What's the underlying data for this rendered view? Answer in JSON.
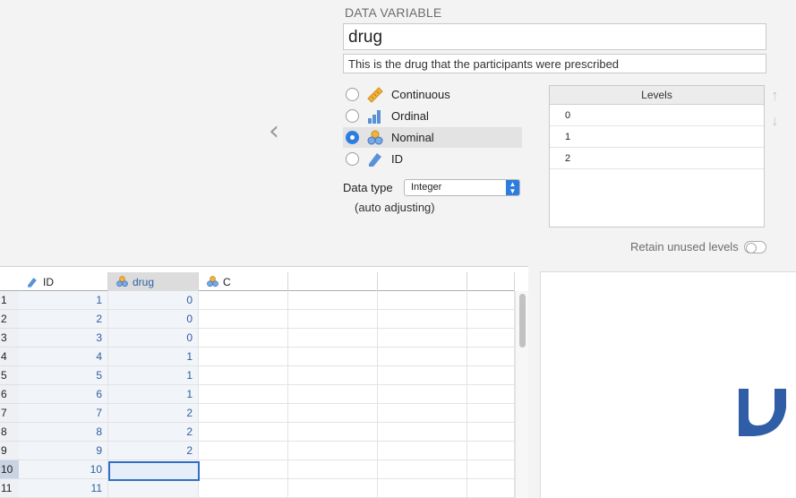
{
  "setup": {
    "back_icon": "chevron-left-icon",
    "section_title": "DATA VARIABLE",
    "variable_name": "drug",
    "description": "This is the drug that the participants were prescribed",
    "measure_types": [
      {
        "label": "Continuous",
        "icon": "ruler-icon",
        "selected": false
      },
      {
        "label": "Ordinal",
        "icon": "bar-chart-icon",
        "selected": false
      },
      {
        "label": "Nominal",
        "icon": "nominal-circles-icon",
        "selected": true
      },
      {
        "label": "ID",
        "icon": "tag-icon",
        "selected": false
      }
    ],
    "data_type_label": "Data type",
    "data_type_value": "Integer",
    "auto_adjust_label": "(auto adjusting)",
    "levels_header": "Levels",
    "levels": [
      "0",
      "1",
      "2"
    ],
    "move_up_icon": "arrow-up-icon",
    "move_down_icon": "arrow-down-icon",
    "retain_label": "Retain unused levels",
    "retain_on": false
  },
  "sheet": {
    "columns": [
      {
        "name": "ID",
        "icon": "tag-icon",
        "selected": false
      },
      {
        "name": "drug",
        "icon": "nominal-circles-icon",
        "selected": true
      },
      {
        "name": "C",
        "icon": "nominal-circles-icon",
        "selected": false
      },
      {
        "name": "",
        "icon": "",
        "selected": false
      },
      {
        "name": "",
        "icon": "",
        "selected": false
      },
      {
        "name": "",
        "icon": "",
        "selected": false
      }
    ],
    "row_numbers": [
      "1",
      "2",
      "3",
      "4",
      "5",
      "6",
      "7",
      "8",
      "9",
      "10",
      "11"
    ],
    "id_values": [
      "1",
      "2",
      "3",
      "4",
      "5",
      "6",
      "7",
      "8",
      "9",
      "10",
      "11"
    ],
    "drug_values": [
      "0",
      "0",
      "0",
      "1",
      "1",
      "1",
      "2",
      "2",
      "2",
      "",
      ""
    ],
    "selected_row": "10"
  },
  "colors": {
    "accent": "#2d7de0",
    "cell_text": "#2f5f9e",
    "logo": "#2f5ea6",
    "ruler": "#f3b23b"
  }
}
